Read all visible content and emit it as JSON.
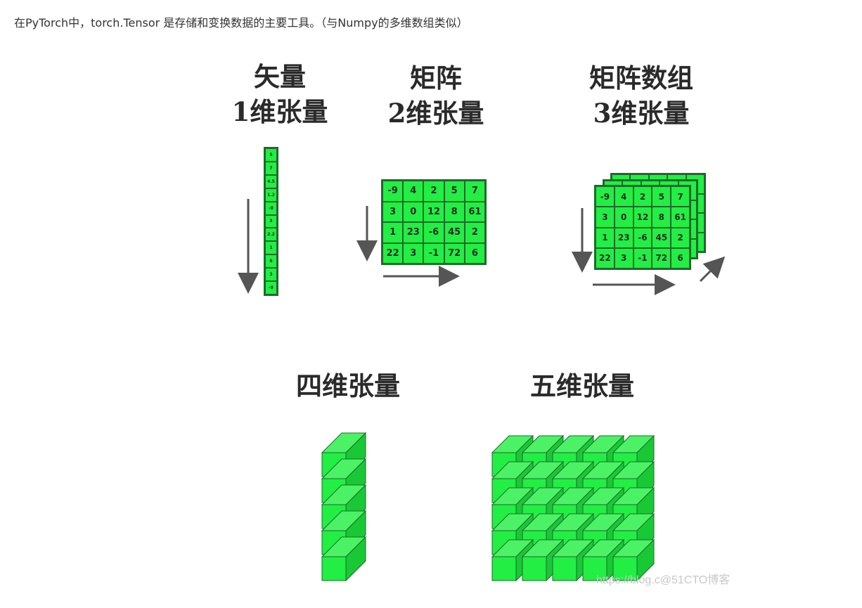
{
  "intro_text": "在PyTorch中，torch.Tensor 是存储和变换数据的主要工具。（与Numpy的多维数组类似）",
  "panels": {
    "vector": {
      "title": "矢量",
      "subtitle": "1维张量",
      "values": [
        "5",
        "7",
        "4.5",
        "1.2",
        "-8",
        "3",
        "2.2",
        "1",
        "6",
        "3",
        "-9"
      ]
    },
    "matrix": {
      "title": "矩阵",
      "subtitle": "2维张量",
      "rows": [
        [
          "-9",
          "4",
          "2",
          "5",
          "7"
        ],
        [
          "3",
          "0",
          "12",
          "8",
          "61"
        ],
        [
          "1",
          "23",
          "-6",
          "45",
          "2"
        ],
        [
          "22",
          "3",
          "-1",
          "72",
          "6"
        ]
      ]
    },
    "array3d": {
      "title": "矩阵数组",
      "subtitle": "3维张量",
      "rows": [
        [
          "-9",
          "4",
          "2",
          "5",
          "7"
        ],
        [
          "3",
          "0",
          "12",
          "8",
          "61"
        ],
        [
          "1",
          "23",
          "-6",
          "45",
          "2"
        ],
        [
          "22",
          "3",
          "-1",
          "72",
          "6"
        ]
      ]
    },
    "tensor4d": {
      "title": "四维张量"
    },
    "tensor5d": {
      "title": "五维张量"
    }
  },
  "watermark": "https://blog.c@51CTO博客",
  "colors": {
    "cell_fill": "#22ee44",
    "cell_border": "#1d6b2a",
    "arrow": "#555555",
    "text": "#333333"
  }
}
